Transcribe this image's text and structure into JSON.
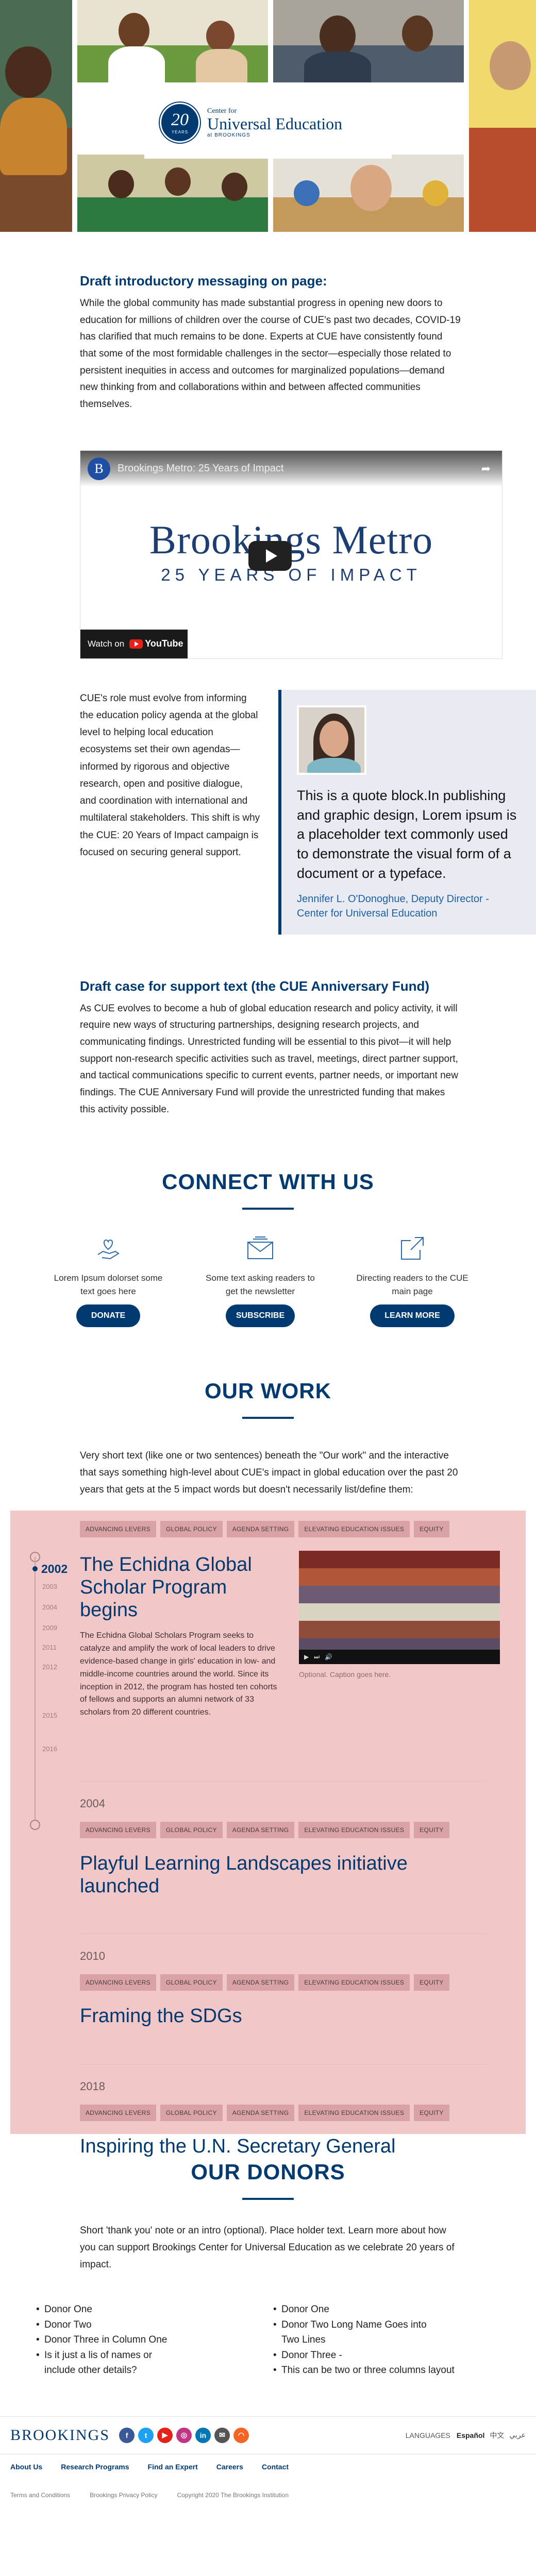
{
  "hero": {
    "logo_number": "20",
    "logo_years": "YEARS",
    "logo_center_for": "Center for",
    "logo_name": "Universal Education",
    "logo_at": "at BROOKINGS"
  },
  "intro": {
    "heading": "Draft introductory messaging on page:",
    "paragraph": "While the global community has made substantial progress in opening new doors to education for millions of children over the course of CUE's past two decades, COVID-19 has clarified that much remains to be done. Experts at CUE have consistently found that some of the most formidable challenges in the sector—especially those related to persistent inequities in access and outcomes for marginalized populations—demand new thinking from and collaborations within and between affected communities themselves."
  },
  "video": {
    "channel_initial": "B",
    "title": "Brookings Metro: 25 Years of Impact",
    "headline": "Brookings Metro",
    "subline": "25 YEARS OF IMPACT",
    "watch_on": "Watch on",
    "platform": "YouTube"
  },
  "role": {
    "paragraph": "CUE's role must evolve from informing the education policy agenda at the global level to helping local education ecosystems set their own agendas—informed by rigorous and objective research, open and positive dialogue, and coordination with international and multilateral stakeholders. This shift is why the CUE: 20 Years of Impact campaign is focused on securing general support."
  },
  "quote": {
    "text": "This is a quote block.In publishing and graphic design, Lorem ipsum is a placeholder text commonly used to demonstrate the visual form of a document or a typeface.",
    "attribution": "Jennifer L. O'Donoghue, Deputy Director - Center for Universal Education"
  },
  "case": {
    "heading": "Draft case for support text (the CUE Anniversary Fund)",
    "paragraph": "As CUE evolves to become a hub of global education research and policy activity, it will require new ways of structuring partnerships, designing research projects, and communicating findings. Unrestricted funding will be essential to this pivot—it will help support non-research specific activities such as travel, meetings, direct partner support, and tactical communications specific to current events, partner needs, or important new findings. The CUE Anniversary Fund will provide the unrestricted funding that makes this activity possible."
  },
  "connect": {
    "title": "CONNECT WITH US",
    "items": [
      {
        "icon": "hand-heart-icon",
        "text": "Lorem Ipsum dolorset some text goes here",
        "button": "DONATE"
      },
      {
        "icon": "envelope-icon",
        "text": "Some text asking readers to get the newsletter",
        "button": "SUBSCRIBE"
      },
      {
        "icon": "external-link-icon",
        "text": "Directing readers to the CUE main page",
        "button": "LEARN MORE"
      }
    ]
  },
  "work": {
    "title": "OUR WORK",
    "intro": "Very short text (like one or two sentences) beneath the \"Our work\" and the interactive that says something high-level about CUE's impact in global education over the past 20 years that gets at the 5 impact words but doesn't necessarily list/define them:",
    "tags": [
      "ADVANCING LEVERS",
      "GLOBAL POLICY",
      "AGENDA SETTING",
      "ELEVATING EDUCATION ISSUES",
      "EQUITY"
    ],
    "timeline_years": [
      "2003",
      "2004",
      "2009",
      "2011",
      "2012",
      "2015",
      "2016"
    ],
    "active_year": "2002",
    "featured": {
      "title": "The Echidna Global Scholar Program begins",
      "description": "The Echidna Global Scholars Program seeks to catalyze and amplify the work of local leaders to drive evidence-based change in girls' education in low- and middle-income countries around the world. Since its inception in 2012, the program has hosted ten cohorts of fellows and supports an alumni network of 33 scholars from 20 different countries.",
      "caption": "Optional. Caption goes here."
    },
    "entries": [
      {
        "year": "2004",
        "title": "Playful Learning Landscapes initiative launched"
      },
      {
        "year": "2010",
        "title": "Framing the SDGs"
      },
      {
        "year": "2018",
        "title": "Inspiring the U.N. Secretary General"
      }
    ]
  },
  "donors": {
    "title": "OUR DONORS",
    "intro": "Short 'thank you' note or an intro (optional). Place holder text. Learn more about how you can support Brookings Center for Universal Education as we celebrate 20 years of impact.",
    "col1": [
      "Donor One",
      "Donor Two",
      "Donor Three in Column One",
      "Is it just a lis of names or include other details?"
    ],
    "col2": [
      "Donor One",
      "Donor Two Long Name Goes into Two Lines",
      "Donor Three -",
      "This can be two or three columns layout"
    ]
  },
  "footer": {
    "brand": "BROOKINGS",
    "languages_label": "LANGUAGES",
    "languages": [
      "Español",
      "中文",
      "عربي"
    ],
    "links": [
      "About Us",
      "Research Programs",
      "Find an Expert",
      "Careers",
      "Contact"
    ],
    "legal": [
      "Terms and Conditions",
      "Brookings Privacy Policy",
      "Copyright 2020 The Brookings Institution"
    ]
  },
  "colors": {
    "navy": "#003a70",
    "pink_panel": "#f2c7c8",
    "tag": "#d9a3a6",
    "quote_bg": "#e8ecf2"
  }
}
